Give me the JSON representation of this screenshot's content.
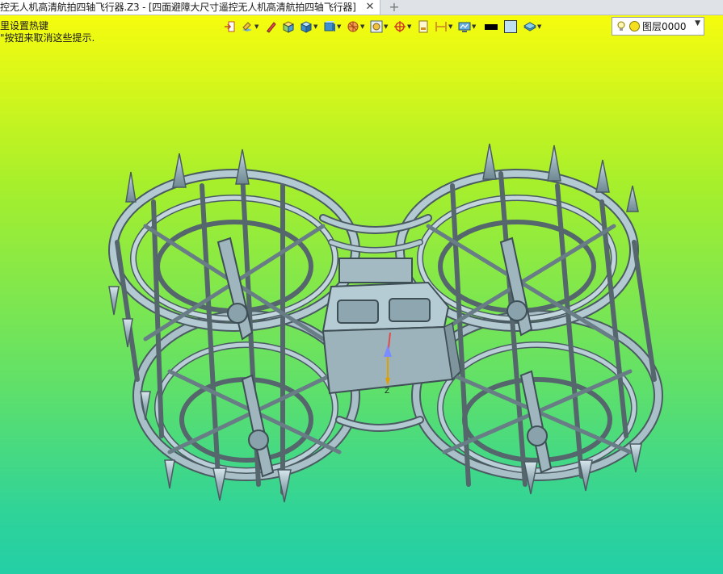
{
  "tab": {
    "title": "控无人机高清航拍四轴飞行器.Z3 - [四面避障大尺寸遥控无人机高清航拍四轴飞行器]",
    "close_icon": "close-icon",
    "new_tab_label": "+"
  },
  "hints": {
    "line1": "里设置热键",
    "line2": "\"按钮来取消这些提示."
  },
  "toolbar": {
    "buttons": [
      {
        "name": "exit-icon",
        "has_dropdown": false
      },
      {
        "name": "render-mode-icon",
        "has_dropdown": true
      },
      {
        "name": "pen-icon",
        "has_dropdown": false
      },
      {
        "name": "shaded-box-icon",
        "has_dropdown": false
      },
      {
        "name": "solid-cube-icon",
        "has_dropdown": true
      },
      {
        "name": "view-cube-icon",
        "has_dropdown": true
      },
      {
        "name": "sphere-filter-icon",
        "has_dropdown": true
      },
      {
        "name": "zoom-fit-icon",
        "has_dropdown": true
      },
      {
        "name": "snap-target-icon",
        "has_dropdown": true
      },
      {
        "name": "page-icon",
        "has_dropdown": false
      },
      {
        "name": "dimension-icon",
        "has_dropdown": true
      },
      {
        "name": "display-settings-icon",
        "has_dropdown": true
      }
    ],
    "line_color": "#000000",
    "fill_color": "#bfe0f0"
  },
  "layer": {
    "bulb_icon": "lightbulb-icon",
    "color_icon": "layer-color-dot",
    "name": "图层0000"
  },
  "colors": {
    "background_top": "#ffff00",
    "background_bottom": "#24cfa6",
    "model": "#9fb6bf"
  }
}
